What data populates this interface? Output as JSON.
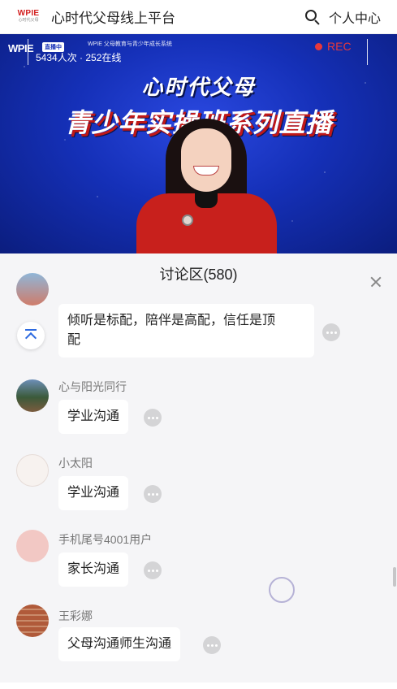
{
  "header": {
    "logo_text": "WPIE",
    "logo_sub": "心时代父母",
    "title": "心时代父母线上平台",
    "personal_center": "个人中心"
  },
  "video": {
    "brand": "WPIE",
    "badge": "直播中",
    "org": "WPIE 父母教育与青少年成长系统",
    "viewer_stats": "5434人次 · 252在线",
    "rec_label": "REC",
    "banner_line1": "心时代父母",
    "banner_line2": "青少年实操班系列直播"
  },
  "discussion": {
    "title": "讨论区(580)",
    "messages": [
      {
        "user": "",
        "text_line1": "倾听是标配，陪伴是高配，信任是顶",
        "text_line2": "配"
      },
      {
        "user": "心与阳光同行",
        "text": "学业沟通"
      },
      {
        "user": "小太阳",
        "text": "学业沟通"
      },
      {
        "user": "手机尾号4001用户",
        "text": "家长沟通"
      },
      {
        "user": "王彩娜",
        "text": "父母沟通师生沟通"
      }
    ]
  },
  "icons": {
    "search": "search-icon",
    "close": "close-icon",
    "scroll_top": "arrow-up-to-top-icon",
    "more": "more-horizontal-icon"
  },
  "colors": {
    "accent_blue": "#2d6ae0",
    "rec_red": "#e8383c",
    "video_blue": "#1530b8",
    "panel_bg": "#f5f5f7"
  }
}
